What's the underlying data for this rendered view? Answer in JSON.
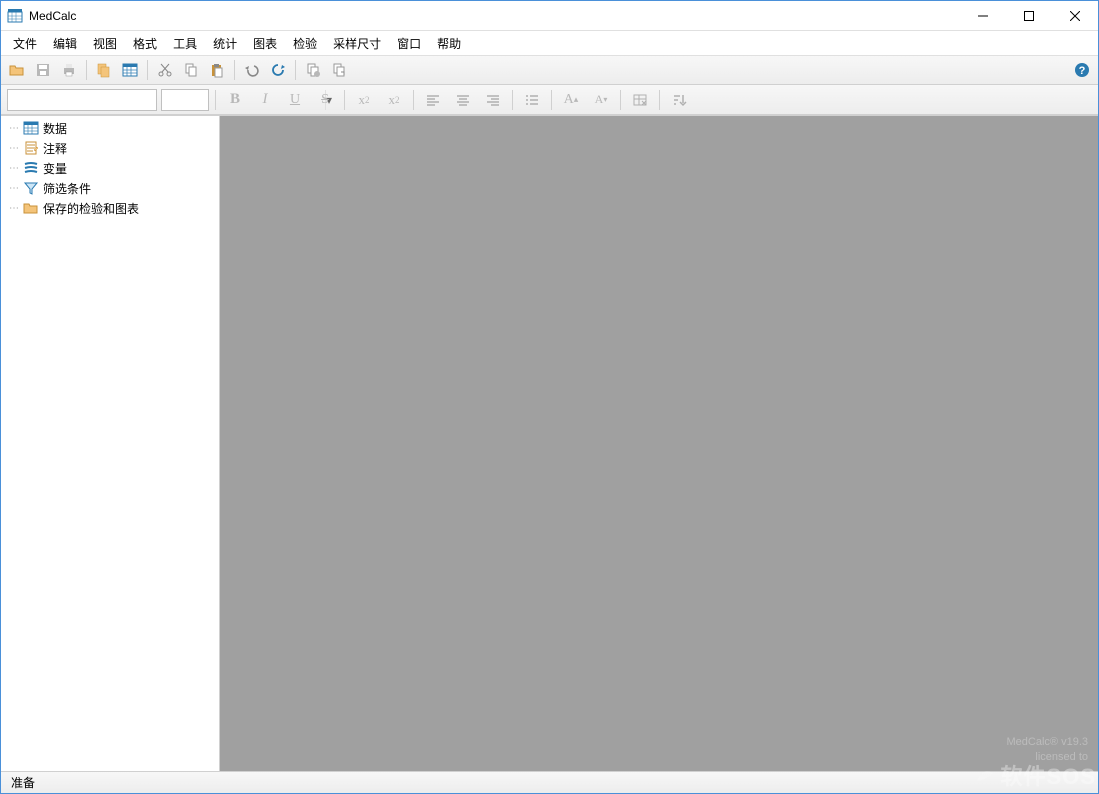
{
  "title": "MedCalc",
  "menu": [
    "文件",
    "编辑",
    "视图",
    "格式",
    "工具",
    "统计",
    "图表",
    "检验",
    "采样尺寸",
    "窗口",
    "帮助"
  ],
  "sidebar": {
    "items": [
      {
        "label": "数据"
      },
      {
        "label": "注释"
      },
      {
        "label": "变量"
      },
      {
        "label": "筛选条件"
      },
      {
        "label": "保存的检验和图表"
      }
    ]
  },
  "watermark": {
    "line1": "MedCalc® v19.3",
    "line2": "licensed to"
  },
  "status": "准备",
  "overlay_brand": "软件SOS"
}
